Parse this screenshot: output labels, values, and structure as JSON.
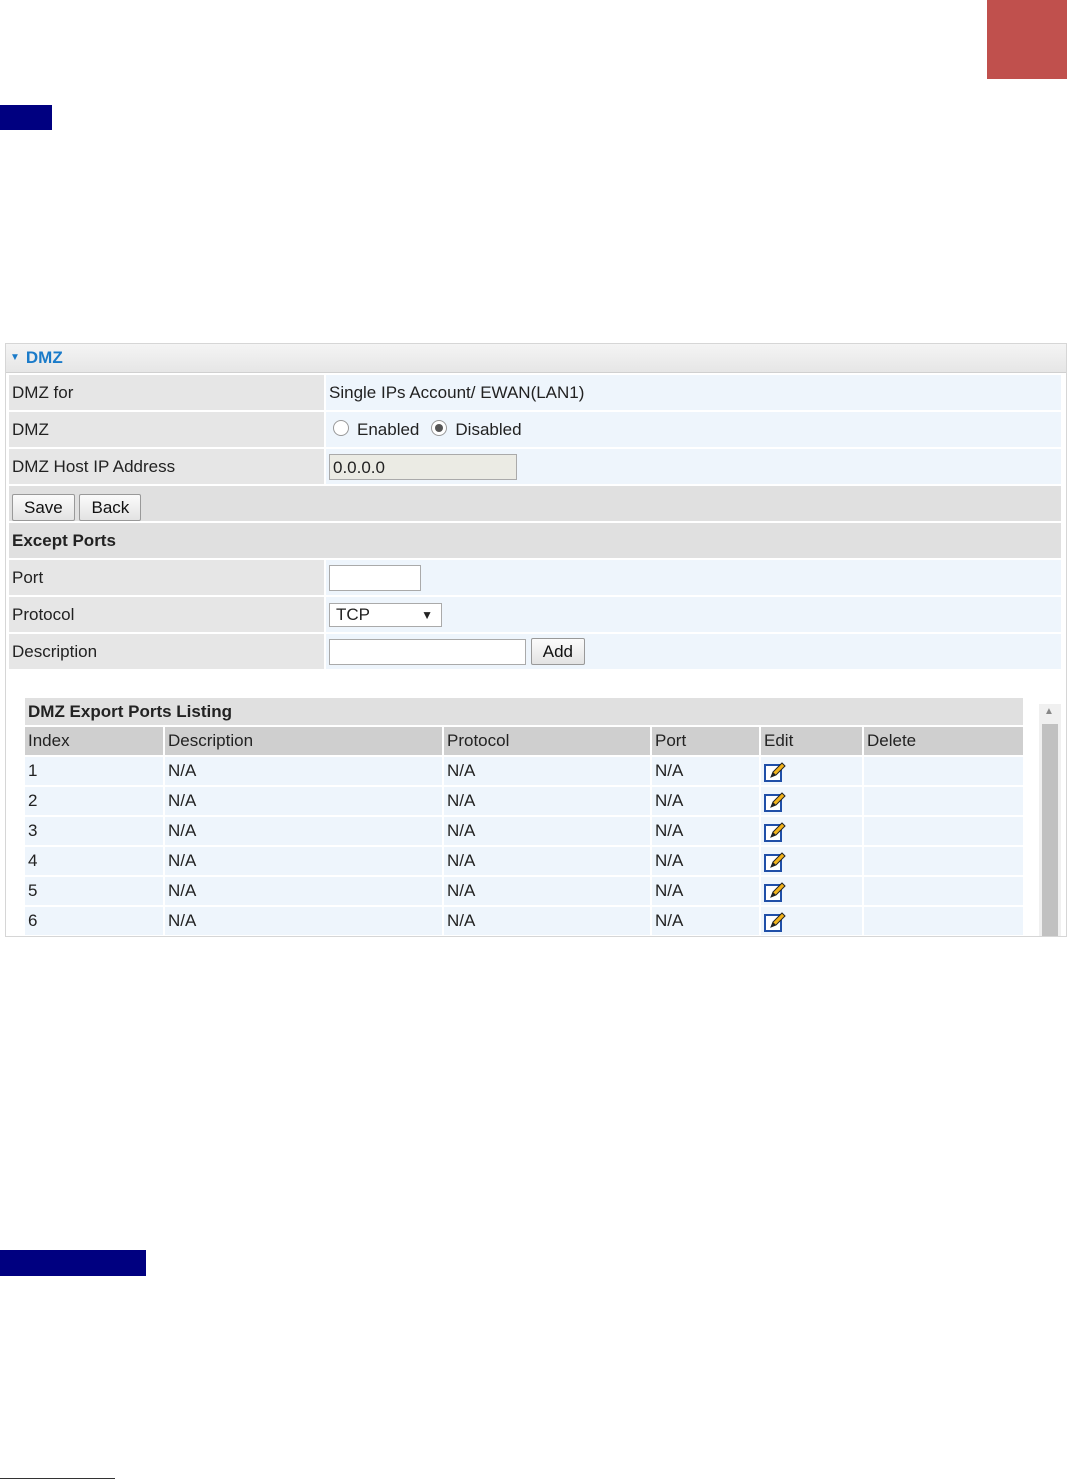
{
  "panel": {
    "title": "DMZ",
    "rows": {
      "dmz_for": {
        "label": "DMZ for",
        "value": "Single IPs Account/ EWAN(LAN1)"
      },
      "dmz": {
        "label": "DMZ",
        "option_enabled": "Enabled",
        "option_disabled": "Disabled",
        "selected": "Disabled"
      },
      "host_ip": {
        "label": "DMZ Host IP Address",
        "value": "0.0.0.0"
      }
    },
    "buttons": {
      "save": "Save",
      "back": "Back"
    },
    "except_ports": {
      "title": "Except Ports",
      "port_label": "Port",
      "port_value": "",
      "protocol_label": "Protocol",
      "protocol_value": "TCP",
      "description_label": "Description",
      "description_value": "",
      "add_button": "Add"
    },
    "listing": {
      "title": "DMZ Export Ports Listing",
      "columns": [
        "Index",
        "Description",
        "Protocol",
        "Port",
        "Edit",
        "Delete"
      ],
      "rows": [
        {
          "index": "1",
          "description": "N/A",
          "protocol": "N/A",
          "port": "N/A"
        },
        {
          "index": "2",
          "description": "N/A",
          "protocol": "N/A",
          "port": "N/A"
        },
        {
          "index": "3",
          "description": "N/A",
          "protocol": "N/A",
          "port": "N/A"
        },
        {
          "index": "4",
          "description": "N/A",
          "protocol": "N/A",
          "port": "N/A"
        },
        {
          "index": "5",
          "description": "N/A",
          "protocol": "N/A",
          "port": "N/A"
        },
        {
          "index": "6",
          "description": "N/A",
          "protocol": "N/A",
          "port": "N/A"
        }
      ]
    }
  },
  "colors": {
    "accent_tab": "#c0504d",
    "nav_block": "#000080",
    "header_text": "#1a7bc9"
  }
}
